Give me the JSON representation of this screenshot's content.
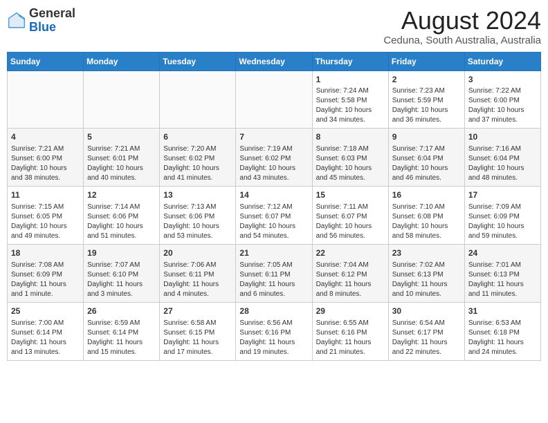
{
  "header": {
    "logo_general": "General",
    "logo_blue": "Blue",
    "month": "August 2024",
    "location": "Ceduna, South Australia, Australia"
  },
  "days_of_week": [
    "Sunday",
    "Monday",
    "Tuesday",
    "Wednesday",
    "Thursday",
    "Friday",
    "Saturday"
  ],
  "weeks": [
    [
      {
        "day": "",
        "info": ""
      },
      {
        "day": "",
        "info": ""
      },
      {
        "day": "",
        "info": ""
      },
      {
        "day": "",
        "info": ""
      },
      {
        "day": "1",
        "info": "Sunrise: 7:24 AM\nSunset: 5:58 PM\nDaylight: 10 hours\nand 34 minutes."
      },
      {
        "day": "2",
        "info": "Sunrise: 7:23 AM\nSunset: 5:59 PM\nDaylight: 10 hours\nand 36 minutes."
      },
      {
        "day": "3",
        "info": "Sunrise: 7:22 AM\nSunset: 6:00 PM\nDaylight: 10 hours\nand 37 minutes."
      }
    ],
    [
      {
        "day": "4",
        "info": "Sunrise: 7:21 AM\nSunset: 6:00 PM\nDaylight: 10 hours\nand 38 minutes."
      },
      {
        "day": "5",
        "info": "Sunrise: 7:21 AM\nSunset: 6:01 PM\nDaylight: 10 hours\nand 40 minutes."
      },
      {
        "day": "6",
        "info": "Sunrise: 7:20 AM\nSunset: 6:02 PM\nDaylight: 10 hours\nand 41 minutes."
      },
      {
        "day": "7",
        "info": "Sunrise: 7:19 AM\nSunset: 6:02 PM\nDaylight: 10 hours\nand 43 minutes."
      },
      {
        "day": "8",
        "info": "Sunrise: 7:18 AM\nSunset: 6:03 PM\nDaylight: 10 hours\nand 45 minutes."
      },
      {
        "day": "9",
        "info": "Sunrise: 7:17 AM\nSunset: 6:04 PM\nDaylight: 10 hours\nand 46 minutes."
      },
      {
        "day": "10",
        "info": "Sunrise: 7:16 AM\nSunset: 6:04 PM\nDaylight: 10 hours\nand 48 minutes."
      }
    ],
    [
      {
        "day": "11",
        "info": "Sunrise: 7:15 AM\nSunset: 6:05 PM\nDaylight: 10 hours\nand 49 minutes."
      },
      {
        "day": "12",
        "info": "Sunrise: 7:14 AM\nSunset: 6:06 PM\nDaylight: 10 hours\nand 51 minutes."
      },
      {
        "day": "13",
        "info": "Sunrise: 7:13 AM\nSunset: 6:06 PM\nDaylight: 10 hours\nand 53 minutes."
      },
      {
        "day": "14",
        "info": "Sunrise: 7:12 AM\nSunset: 6:07 PM\nDaylight: 10 hours\nand 54 minutes."
      },
      {
        "day": "15",
        "info": "Sunrise: 7:11 AM\nSunset: 6:07 PM\nDaylight: 10 hours\nand 56 minutes."
      },
      {
        "day": "16",
        "info": "Sunrise: 7:10 AM\nSunset: 6:08 PM\nDaylight: 10 hours\nand 58 minutes."
      },
      {
        "day": "17",
        "info": "Sunrise: 7:09 AM\nSunset: 6:09 PM\nDaylight: 10 hours\nand 59 minutes."
      }
    ],
    [
      {
        "day": "18",
        "info": "Sunrise: 7:08 AM\nSunset: 6:09 PM\nDaylight: 11 hours\nand 1 minute."
      },
      {
        "day": "19",
        "info": "Sunrise: 7:07 AM\nSunset: 6:10 PM\nDaylight: 11 hours\nand 3 minutes."
      },
      {
        "day": "20",
        "info": "Sunrise: 7:06 AM\nSunset: 6:11 PM\nDaylight: 11 hours\nand 4 minutes."
      },
      {
        "day": "21",
        "info": "Sunrise: 7:05 AM\nSunset: 6:11 PM\nDaylight: 11 hours\nand 6 minutes."
      },
      {
        "day": "22",
        "info": "Sunrise: 7:04 AM\nSunset: 6:12 PM\nDaylight: 11 hours\nand 8 minutes."
      },
      {
        "day": "23",
        "info": "Sunrise: 7:02 AM\nSunset: 6:13 PM\nDaylight: 11 hours\nand 10 minutes."
      },
      {
        "day": "24",
        "info": "Sunrise: 7:01 AM\nSunset: 6:13 PM\nDaylight: 11 hours\nand 11 minutes."
      }
    ],
    [
      {
        "day": "25",
        "info": "Sunrise: 7:00 AM\nSunset: 6:14 PM\nDaylight: 11 hours\nand 13 minutes."
      },
      {
        "day": "26",
        "info": "Sunrise: 6:59 AM\nSunset: 6:14 PM\nDaylight: 11 hours\nand 15 minutes."
      },
      {
        "day": "27",
        "info": "Sunrise: 6:58 AM\nSunset: 6:15 PM\nDaylight: 11 hours\nand 17 minutes."
      },
      {
        "day": "28",
        "info": "Sunrise: 6:56 AM\nSunset: 6:16 PM\nDaylight: 11 hours\nand 19 minutes."
      },
      {
        "day": "29",
        "info": "Sunrise: 6:55 AM\nSunset: 6:16 PM\nDaylight: 11 hours\nand 21 minutes."
      },
      {
        "day": "30",
        "info": "Sunrise: 6:54 AM\nSunset: 6:17 PM\nDaylight: 11 hours\nand 22 minutes."
      },
      {
        "day": "31",
        "info": "Sunrise: 6:53 AM\nSunset: 6:18 PM\nDaylight: 11 hours\nand 24 minutes."
      }
    ]
  ]
}
